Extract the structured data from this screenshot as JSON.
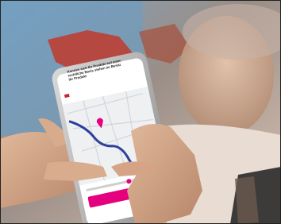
{
  "photo": {
    "subject": "hands-holding-smartphone-with-route-map",
    "phone_text_lines": [
      "Konnen sich Ihr Produkt auf einer",
      "rechtliche Basis stehen im Besitz",
      "Ihr Produkt"
    ],
    "button_label": "",
    "colors": {
      "accent_magenta": "#e5007e",
      "route_blue": "#2b3f9c",
      "background_red": "#c0392b",
      "background_blue": "#5f8fb4"
    }
  }
}
